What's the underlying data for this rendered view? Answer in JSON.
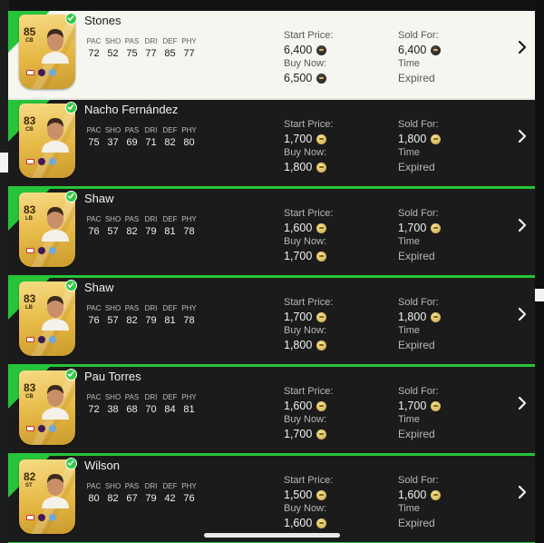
{
  "labels": {
    "start_price": "Start Price:",
    "sold_for": "Sold For:",
    "buy_now": "Buy Now:",
    "time": "Time",
    "stat_headers": [
      "PAC",
      "SHO",
      "PAS",
      "DRI",
      "DEF",
      "PHY"
    ]
  },
  "colors": {
    "accent_green": "#27c43a",
    "card_gold": "#e6b845",
    "row_dark": "#1b1b1b",
    "row_selected": "#f6f6f1"
  },
  "icons": {
    "coin": "coin-icon",
    "check": "check-icon",
    "chevron": "chevron-right-icon"
  },
  "players": [
    {
      "name": "Stones",
      "rating": "85",
      "position": "CB",
      "stats": [
        "72",
        "52",
        "75",
        "77",
        "85",
        "77"
      ],
      "start_price": "6,400",
      "buy_now": "6,500",
      "sold_for": "6,400",
      "time": "Expired",
      "selected": true
    },
    {
      "name": "Nacho Fernández",
      "rating": "83",
      "position": "CB",
      "stats": [
        "75",
        "37",
        "69",
        "71",
        "82",
        "80"
      ],
      "start_price": "1,700",
      "buy_now": "1,800",
      "sold_for": "1,800",
      "time": "Expired"
    },
    {
      "name": "Shaw",
      "rating": "83",
      "position": "LB",
      "stats": [
        "76",
        "57",
        "82",
        "79",
        "81",
        "78"
      ],
      "start_price": "1,600",
      "buy_now": "1,700",
      "sold_for": "1,700",
      "time": "Expired"
    },
    {
      "name": "Shaw",
      "rating": "83",
      "position": "LB",
      "stats": [
        "76",
        "57",
        "82",
        "79",
        "81",
        "78"
      ],
      "start_price": "1,700",
      "buy_now": "1,800",
      "sold_for": "1,800",
      "time": "Expired"
    },
    {
      "name": "Pau Torres",
      "rating": "83",
      "position": "CB",
      "stats": [
        "72",
        "38",
        "68",
        "70",
        "84",
        "81"
      ],
      "start_price": "1,600",
      "buy_now": "1,700",
      "sold_for": "1,700",
      "time": "Expired"
    },
    {
      "name": "Wilson",
      "rating": "82",
      "position": "ST",
      "stats": [
        "80",
        "82",
        "67",
        "79",
        "42",
        "76"
      ],
      "start_price": "1,500",
      "buy_now": "1,600",
      "sold_for": "1,600",
      "time": "Expired"
    }
  ]
}
